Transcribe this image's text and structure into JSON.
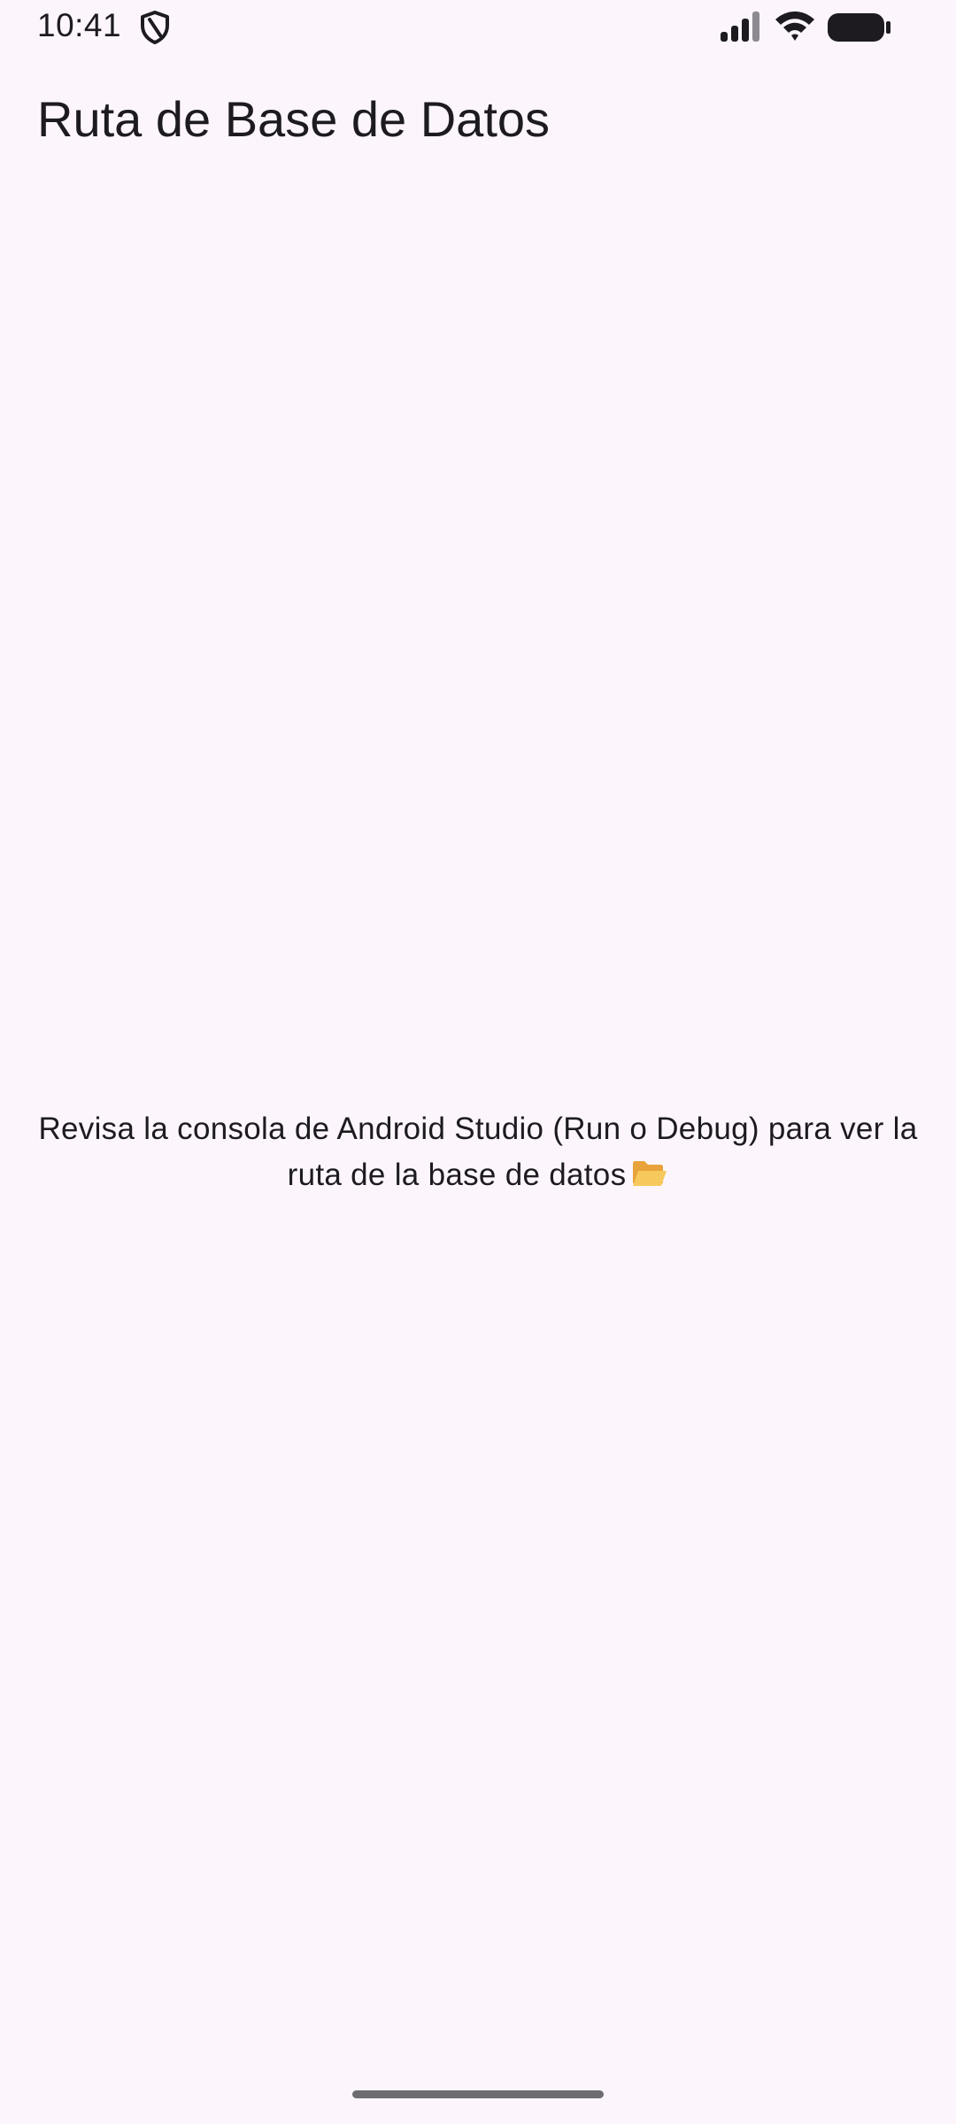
{
  "status_bar": {
    "time": "10:41",
    "icons": [
      "shield-icon",
      "signal-icon",
      "wifi-icon",
      "battery-icon"
    ]
  },
  "app_bar": {
    "title": "Ruta de Base de Datos"
  },
  "body": {
    "message_line1": "Revisa la consola de Android Studio (Run o Debug) para ver la",
    "message_line2": "ruta de la base de datos",
    "message_icon": "open-folder-icon"
  },
  "colors": {
    "background": "#FCF6FC",
    "text": "#1D1B20",
    "home_indicator": "#6E6B73"
  }
}
